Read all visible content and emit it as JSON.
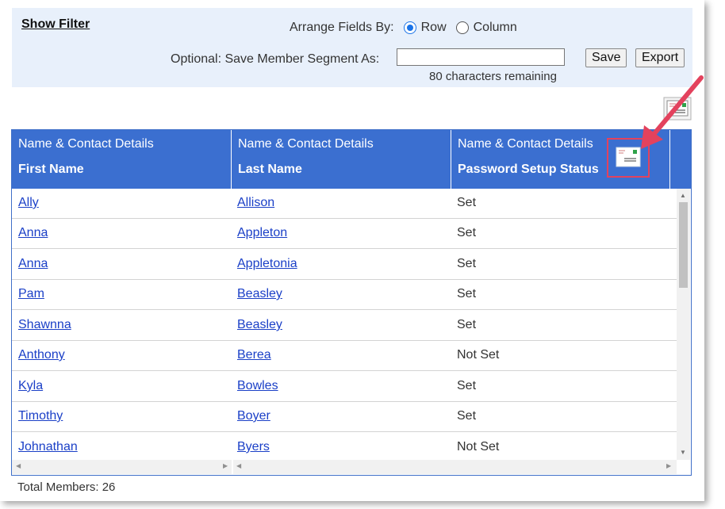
{
  "filter": {
    "show_filter_label": "Show Filter",
    "arrange_label": "Arrange Fields By:",
    "row_label": "Row",
    "column_label": "Column",
    "selected": "Row",
    "save_segment_label": "Optional: Save Member Segment As:",
    "segment_value": "",
    "chars_remaining": "80 characters remaining",
    "save_button": "Save",
    "export_button": "Export"
  },
  "table": {
    "columns": [
      {
        "group": "Name & Contact Details",
        "name": "First Name"
      },
      {
        "group": "Name & Contact Details",
        "name": "Last Name"
      },
      {
        "group": "Name & Contact Details",
        "name": "Password Setup Status"
      }
    ],
    "rows": [
      {
        "first": "Ally",
        "last": "Allison",
        "status": "Set"
      },
      {
        "first": "Anna",
        "last": "Appleton",
        "status": "Set"
      },
      {
        "first": "Anna",
        "last": "Appletonia",
        "status": "Set"
      },
      {
        "first": "Pam",
        "last": "Beasley",
        "status": "Set"
      },
      {
        "first": "Shawnna",
        "last": "Beasley",
        "status": "Set"
      },
      {
        "first": "Anthony",
        "last": "Berea",
        "status": "Not Set"
      },
      {
        "first": "Kyla",
        "last": "Bowles",
        "status": "Set"
      },
      {
        "first": "Timothy",
        "last": "Boyer",
        "status": "Set"
      },
      {
        "first": "Johnathan",
        "last": "Byers",
        "status": "Not Set"
      }
    ]
  },
  "total_members": "Total Members: 26",
  "icons": {
    "email_export": "email-envelope-icon",
    "email_column": "email-envelope-icon",
    "callout": "red-arrow"
  },
  "colors": {
    "header_bg": "#3b6fd0",
    "filter_bg": "#e8f0fb",
    "link": "#1a3fc7",
    "callout": "#e3425d"
  }
}
